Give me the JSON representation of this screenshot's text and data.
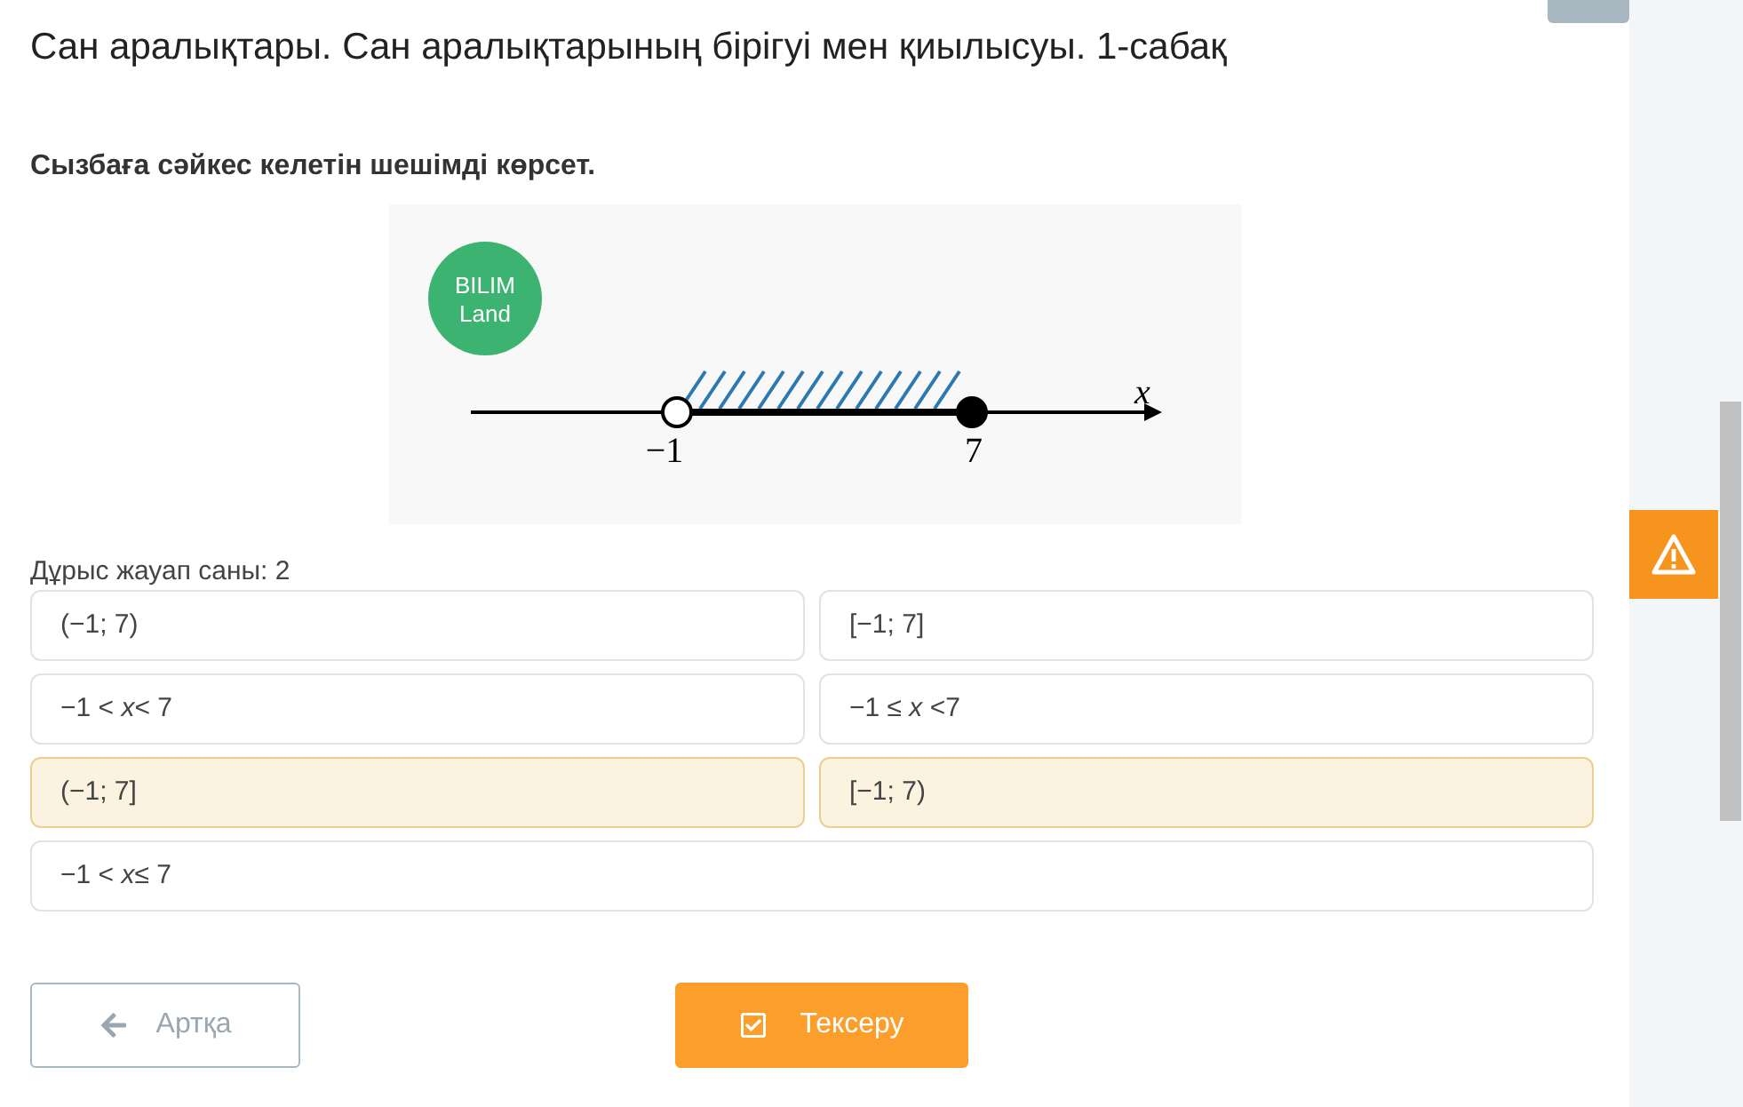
{
  "title": "Сан аралықтары. Сан аралықтарының бірігуі мен қиылысуы. 1-сабақ",
  "question": "Сызбаға сәйкес келетін шешімді көрсет.",
  "diagram": {
    "logo_line_1": "BILIM",
    "logo_line_2": "Land",
    "left_label": "−1",
    "right_label": "7",
    "axis_label": "x",
    "left_open": true,
    "right_open": false
  },
  "answer_count": "Дұрыс жауап саны: 2",
  "options": [
    {
      "text": "(−1; 7)",
      "selected": false
    },
    {
      "text": "[−1; 7]",
      "selected": false
    },
    {
      "text": "−1 < *x*< 7",
      "selected": false
    },
    {
      "text": "−1 ≤ *x* <7",
      "selected": false
    },
    {
      "text": "(−1; 7]",
      "selected": true
    },
    {
      "text": "[−1; 7)",
      "selected": true
    },
    {
      "text": "−1 < *x*≤ 7",
      "selected": false
    }
  ],
  "buttons": {
    "back": "Артқа",
    "check": "Тексеру"
  }
}
